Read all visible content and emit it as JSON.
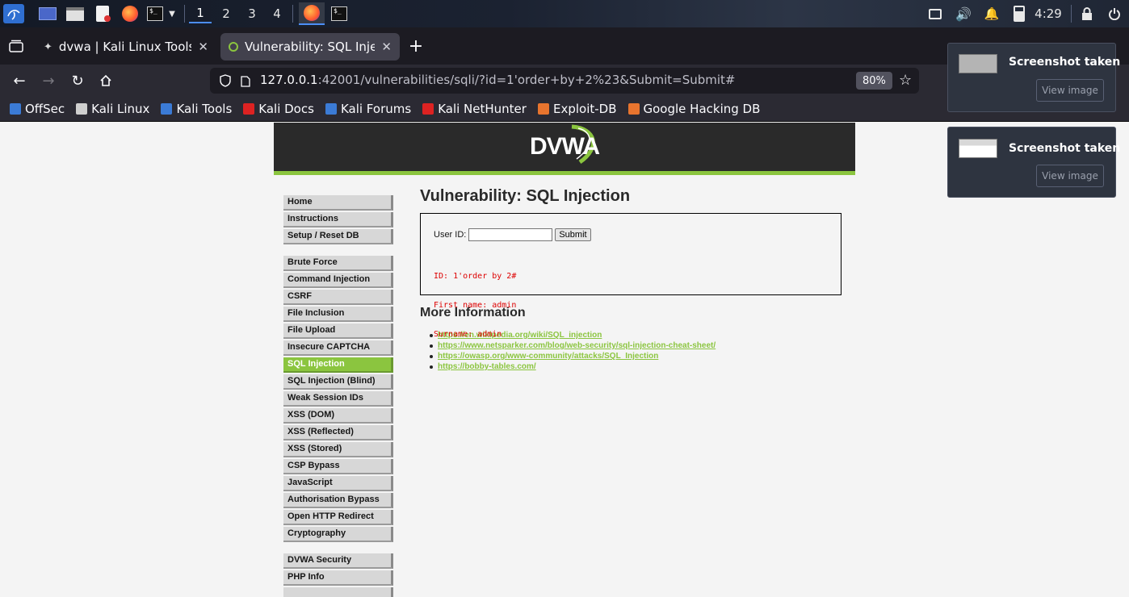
{
  "taskbar": {
    "workspaces": [
      "1",
      "2",
      "3",
      "4"
    ],
    "active_workspace": "1",
    "clock": "4:29"
  },
  "tabs": [
    {
      "title": "dvwa | Kali Linux Tools",
      "active": false
    },
    {
      "title": "Vulnerability: SQL Injectio",
      "active": true
    }
  ],
  "navbar": {
    "url_host": "127.0.0.1",
    "url_rest": ":42001/vulnerabilities/sqli/?id=1'order+by+2%23&Submit=Submit#",
    "zoom": "80%"
  },
  "bookmarks": [
    {
      "label": "OffSec",
      "color": "#3b7bd6"
    },
    {
      "label": "Kali Linux",
      "color": "#cfcfcf"
    },
    {
      "label": "Kali Tools",
      "color": "#3b7bd6"
    },
    {
      "label": "Kali Docs",
      "color": "#d22"
    },
    {
      "label": "Kali Forums",
      "color": "#3b7bd6"
    },
    {
      "label": "Kali NetHunter",
      "color": "#d22"
    },
    {
      "label": "Exploit-DB",
      "color": "#e8742e"
    },
    {
      "label": "Google Hacking DB",
      "color": "#e8742e"
    }
  ],
  "dvwa": {
    "logo": "DVWA",
    "accent": "#8bc53f",
    "menu_groups": [
      [
        "Home",
        "Instructions",
        "Setup / Reset DB"
      ],
      [
        "Brute Force",
        "Command Injection",
        "CSRF",
        "File Inclusion",
        "File Upload",
        "Insecure CAPTCHA",
        "SQL Injection",
        "SQL Injection (Blind)",
        "Weak Session IDs",
        "XSS (DOM)",
        "XSS (Reflected)",
        "XSS (Stored)",
        "CSP Bypass",
        "JavaScript",
        "Authorisation Bypass",
        "Open HTTP Redirect",
        "Cryptography"
      ],
      [
        "DVWA Security",
        "PHP Info"
      ]
    ],
    "selected_menu": "SQL Injection",
    "page_title": "Vulnerability: SQL Injection",
    "form": {
      "label": "User ID:",
      "input_value": "",
      "submit_label": "Submit"
    },
    "result_lines": [
      "ID: 1'order by 2#",
      "First name: admin",
      "Surname: admin"
    ],
    "more_info_title": "More Information",
    "links": [
      "https://en.wikipedia.org/wiki/SQL_injection",
      "https://www.netsparker.com/blog/web-security/sql-injection-cheat-sheet/",
      "https://owasp.org/www-community/attacks/SQL_Injection",
      "https://bobby-tables.com/"
    ]
  },
  "notifications": [
    {
      "title": "Screenshot taken",
      "button": "View image"
    },
    {
      "title": "Screenshot taken",
      "button": "View image"
    }
  ]
}
